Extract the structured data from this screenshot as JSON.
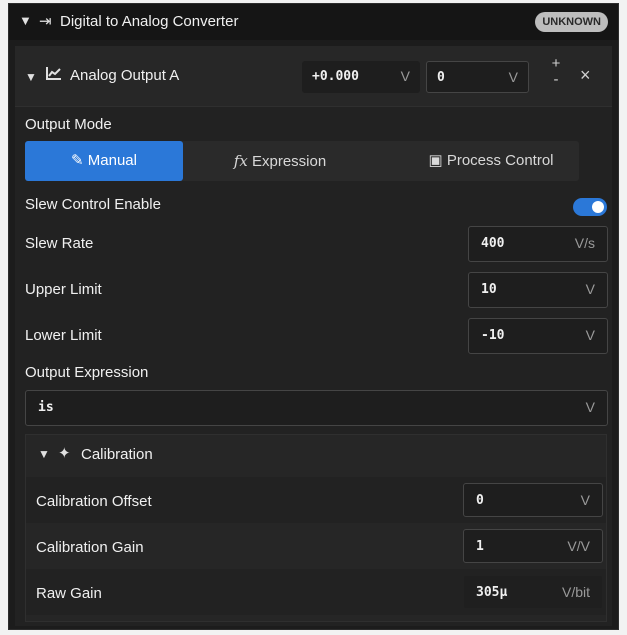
{
  "header": {
    "title": "Digital to Analog Converter",
    "badge": "UNKNOWN"
  },
  "output": {
    "title": "Analog Output A",
    "readout_value": "+0.000",
    "readout_unit": "V",
    "setpoint_value": "0",
    "setpoint_unit": "V",
    "increment": "+",
    "decrement": "-",
    "close": "×"
  },
  "mode": {
    "label": "Output Mode",
    "tabs": [
      {
        "label": "Manual",
        "icon": "pencil-icon",
        "active": true
      },
      {
        "label": "Expression",
        "icon": "function-icon",
        "active": false
      },
      {
        "label": "Process Control",
        "icon": "camera-icon",
        "active": false
      }
    ],
    "fx_glyph": "fx"
  },
  "slew": {
    "enable_label": "Slew Control Enable",
    "enabled": true
  },
  "fields": {
    "slew_rate": {
      "label": "Slew Rate",
      "value": "400",
      "unit": "V/s"
    },
    "upper": {
      "label": "Upper Limit",
      "value": "10",
      "unit": "V"
    },
    "lower": {
      "label": "Lower Limit",
      "value": "-10",
      "unit": "V"
    }
  },
  "expression": {
    "label": "Output Expression",
    "value": "is",
    "unit": "V"
  },
  "calibration": {
    "title": "Calibration",
    "offset": {
      "label": "Calibration Offset",
      "value": "0",
      "unit": "V"
    },
    "gain": {
      "label": "Calibration Gain",
      "value": "1",
      "unit": "V/V"
    },
    "raw": {
      "label": "Raw Gain",
      "value": "305µ",
      "unit": "V/bit"
    }
  },
  "colors": {
    "accent": "#2b78d8",
    "background": "#1c1c1c",
    "badge": "#bdbdbd"
  }
}
